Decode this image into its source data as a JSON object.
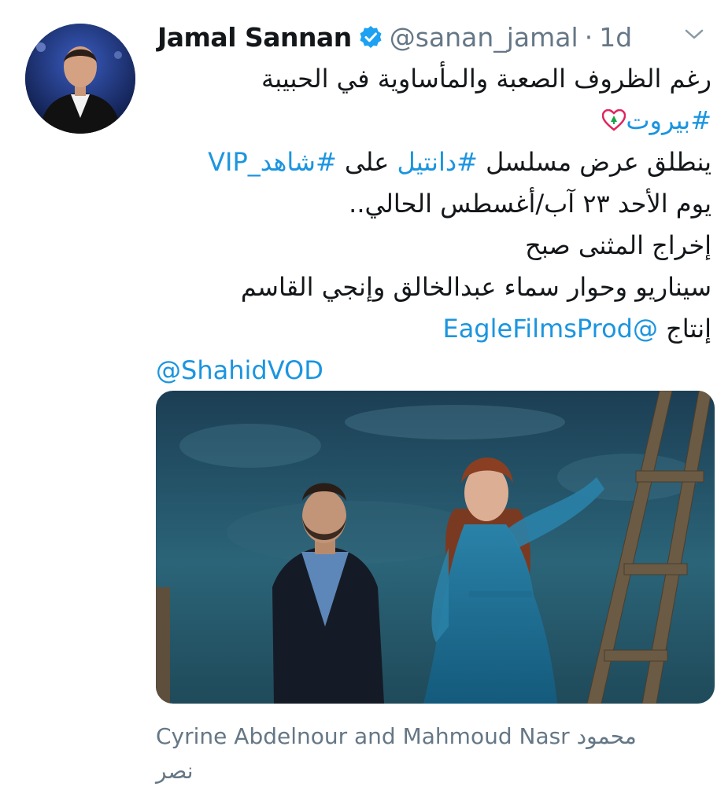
{
  "tweet": {
    "author_name": "Jamal Sannan",
    "handle": "@sanan_jamal",
    "separator": "·",
    "time": "1d",
    "lines": {
      "l1": "رغم الظروف الصعبة والمأساوية في الحبيبة",
      "l2_tag": "#بيروت",
      "l3_a": "ينطلق عرض مسلسل ",
      "l3_tag1": "#دانتيل",
      "l3_b": " على ",
      "l3_tag2": "#شاهد_VIP",
      "l4": "يوم الأحد ٢٣ آب/أغسطس الحالي..",
      "l5": "إخراج المثنى صبح",
      "l6": "سيناريو وحوار سماء عبدالخالق وإنجي القاسم",
      "l7_a": "إنتاج ",
      "l7_mention": "@EagleFilmsProd",
      "l8_mention": "@ShahidVOD"
    },
    "caption": {
      "line1": "Cyrine Abdelnour and Mahmoud Nasr محمود",
      "line2": "نصر"
    }
  },
  "colors": {
    "link": "#1b95e0",
    "muted": "#657786",
    "verified": "#1da1f2",
    "text": "#14171a"
  },
  "icons": [
    "verified-badge-icon",
    "chevron-down-icon",
    "lebanon-heart-icon"
  ]
}
